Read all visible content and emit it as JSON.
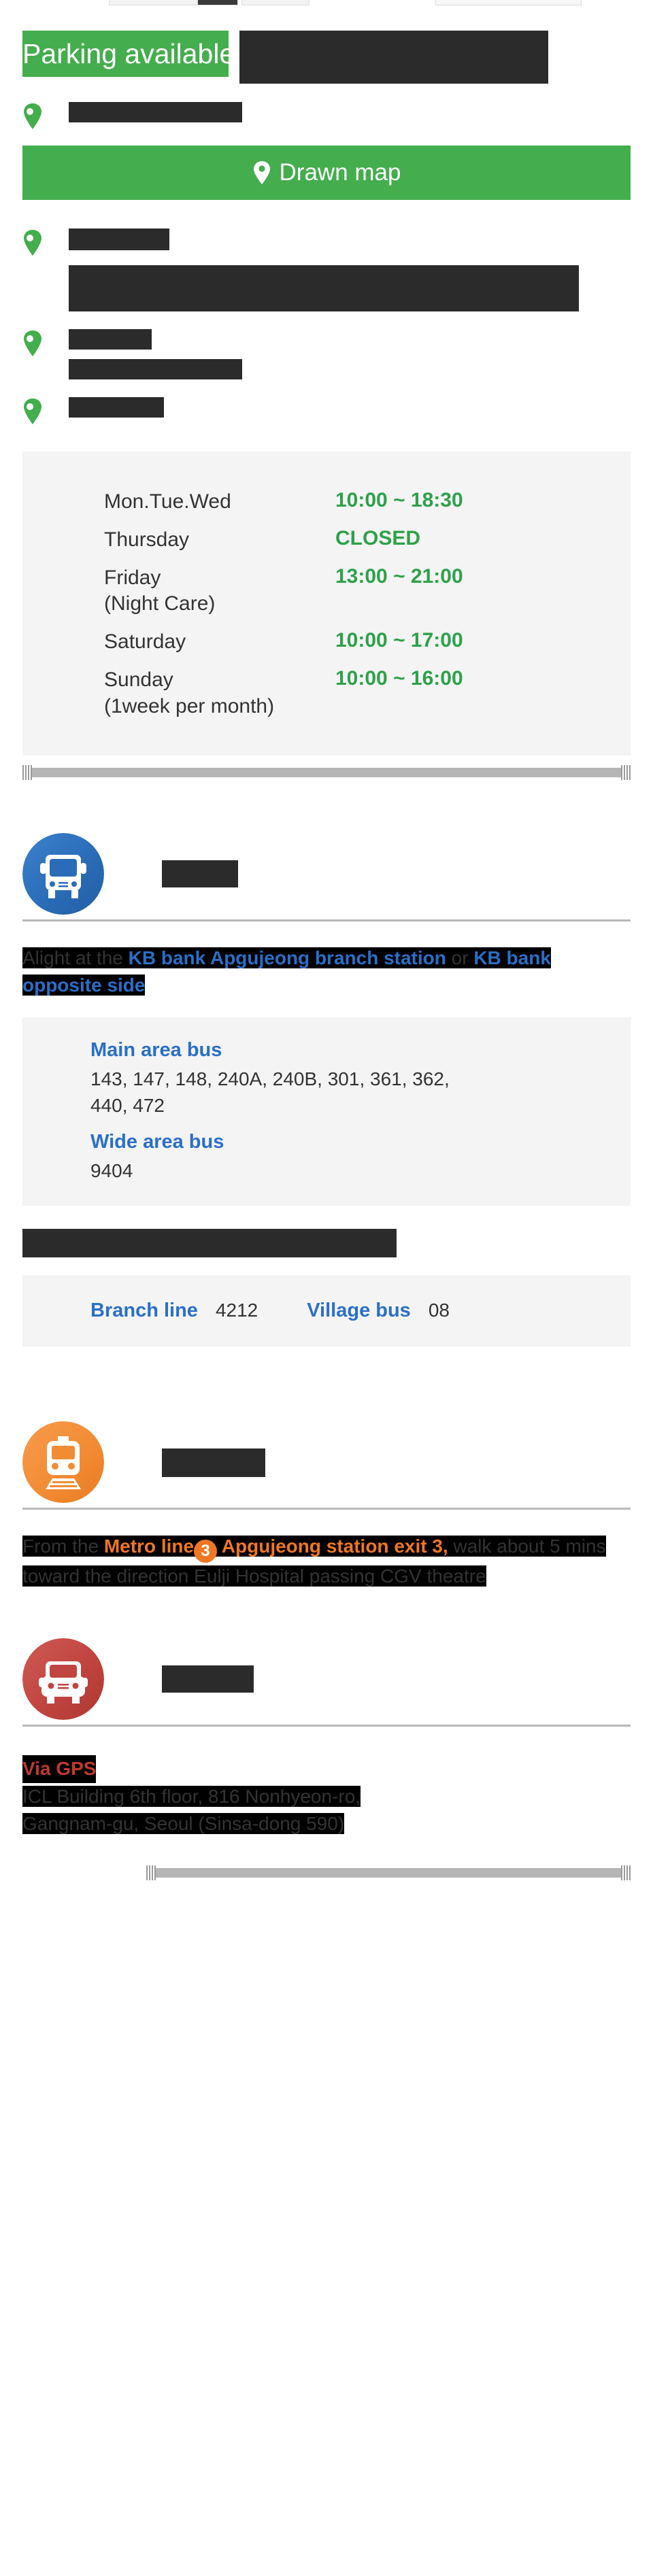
{
  "parking": {
    "badge_label": "Parking available",
    "redacted_note": ""
  },
  "map_button": {
    "label": "Drawn map",
    "icon": "map-pin-icon"
  },
  "pin_sections": [
    {
      "icon": "map-pin-icon",
      "label": ""
    },
    {
      "icon": "map-pin-icon",
      "label": ""
    },
    {
      "icon": "map-pin-icon",
      "label": ""
    },
    {
      "icon": "map-pin-icon",
      "label": ""
    }
  ],
  "hours": {
    "rows": [
      {
        "day": "Mon.Tue.Wed",
        "day_sub": "",
        "time": "10:00 ~ 18:30"
      },
      {
        "day": "Thursday",
        "day_sub": "",
        "time": "CLOSED"
      },
      {
        "day": "Friday",
        "day_sub": "(Night Care)",
        "time": "13:00 ~ 21:00"
      },
      {
        "day": "Saturday",
        "day_sub": "",
        "time": "10:00 ~ 17:00"
      },
      {
        "day": "Sunday",
        "day_sub": "(1week per month)",
        "time": "10:00 ~ 16:00"
      }
    ],
    "open_color": "#2ea14a",
    "closed_color": "#2ea14a"
  },
  "transport": {
    "bus": {
      "icon": "bus-icon",
      "icon_color": "#2a6cb8",
      "title": "",
      "desc_pre": "Alight at the ",
      "desc_link1": "KB bank Apgujeong branch station",
      "desc_mid": " or ",
      "desc_link2": "KB bank opposite side",
      "cards": [
        {
          "cat": "Main area bus",
          "nums": "143, 147, 148, 240A, 240B, 301, 361, 362, 440, 472"
        },
        {
          "cat": "Wide area bus",
          "nums": "9404"
        }
      ],
      "inline_card": {
        "cat1": "Branch line",
        "val1": "4212",
        "cat2": "Village bus",
        "val2": "08"
      }
    },
    "subway": {
      "icon": "subway-icon",
      "icon_color": "#f28c34",
      "title": "",
      "desc_pre": "From the ",
      "metro_label": "Metro line",
      "line_number": "3",
      "desc_station": " Apgujeong station exit 3,",
      "desc_rest": "walk about 5 mins toward the direction Eulji Hospital passing CGV theatre"
    },
    "car": {
      "icon": "car-icon",
      "icon_color": "#c0443f",
      "title": "",
      "gps_title": "Via GPS",
      "address_line1": "ICL Building 6th floor, 816 Nonhyeon-ro,",
      "address_line2": "Gangnam-gu, Seoul (Sinsa-dong 590)"
    }
  },
  "colors": {
    "green": "#44ad4d",
    "blue": "#2a6fc9",
    "orange": "#f07722",
    "red": "#c0392f",
    "card_bg": "#f4f4f4"
  }
}
